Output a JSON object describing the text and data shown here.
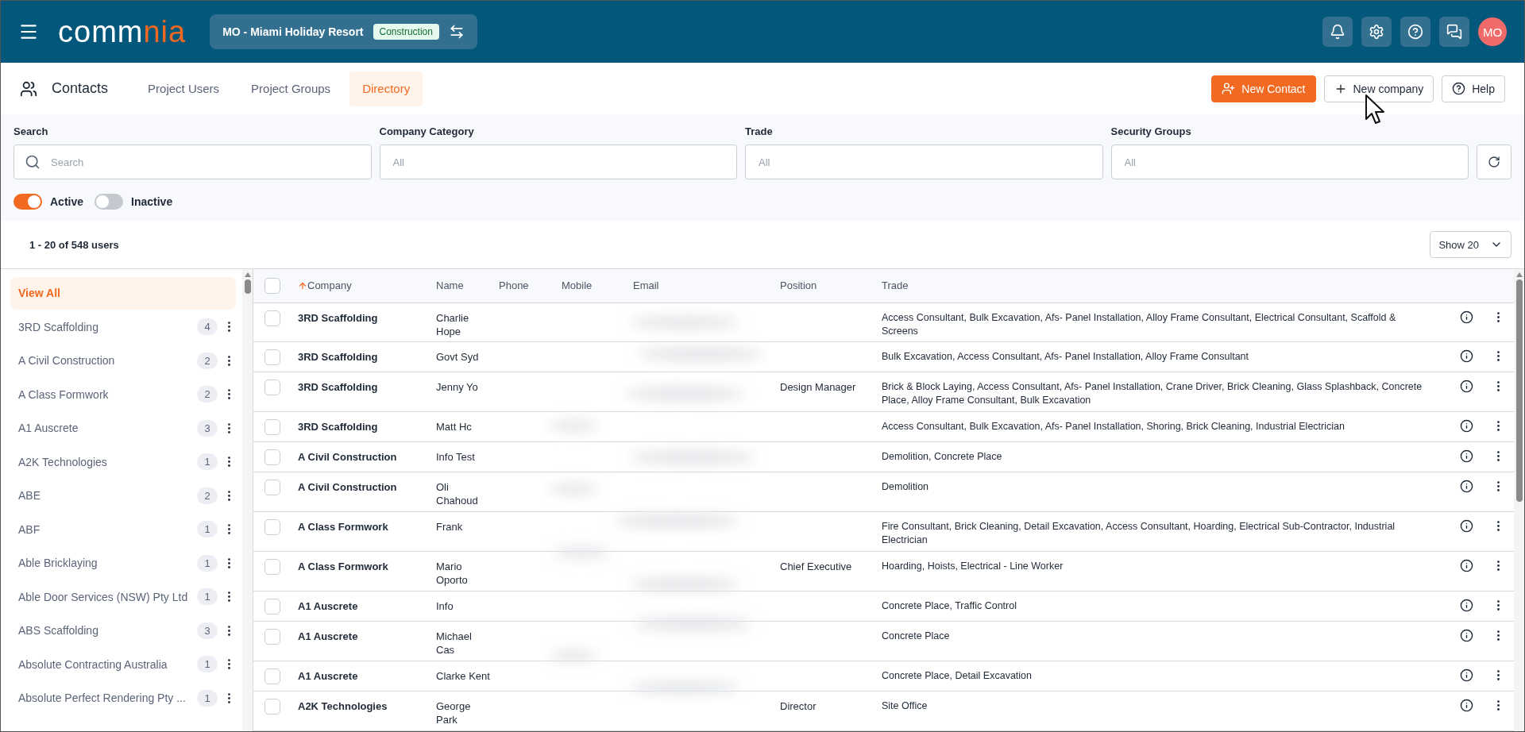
{
  "header": {
    "logo": {
      "primary": "comm",
      "accent": "nia"
    },
    "project": "MO - Miami Holiday Resort",
    "project_badge": "Construction",
    "avatar": "MO"
  },
  "page": {
    "title": "Contacts",
    "tabs": [
      {
        "label": "Project Users",
        "selected": false
      },
      {
        "label": "Project Groups",
        "selected": false
      },
      {
        "label": "Directory",
        "selected": true
      }
    ],
    "actions": [
      {
        "kind": "primary",
        "label": "New Contact"
      },
      {
        "kind": "add",
        "label": "New company"
      },
      {
        "kind": "help",
        "label": "Help"
      }
    ]
  },
  "filters": [
    {
      "kind": "search",
      "label": "Search",
      "placeholder": "Search"
    },
    {
      "kind": "select",
      "label": "Company Category",
      "placeholder": "All"
    },
    {
      "kind": "select",
      "label": "Trade",
      "placeholder": "All"
    },
    {
      "kind": "select",
      "label": "Security Groups",
      "placeholder": "All"
    }
  ],
  "toggles": [
    {
      "label": "Active",
      "on": true
    },
    {
      "label": "Inactive",
      "on": false
    }
  ],
  "count": "1 - 20 of 548 users",
  "page_size": "Show 20",
  "sidebar": {
    "items": [
      {
        "label": "View All",
        "selected": true
      },
      {
        "label": "3RD Scaffolding",
        "count": "4",
        "selected": false
      },
      {
        "label": "A Civil Construction",
        "count": "2",
        "selected": false
      },
      {
        "label": "A Class Formwork",
        "count": "2",
        "selected": false
      },
      {
        "label": "A1 Auscrete",
        "count": "3",
        "selected": false
      },
      {
        "label": "A2K Technologies",
        "count": "1",
        "selected": false
      },
      {
        "label": "ABE",
        "count": "2",
        "selected": false
      },
      {
        "label": "ABF",
        "count": "1",
        "selected": false
      },
      {
        "label": "Able Bricklaying",
        "count": "1",
        "selected": false
      },
      {
        "label": "Able Door Services (NSW) Pty Ltd",
        "count": "1",
        "selected": false
      },
      {
        "label": "ABS Scaffolding",
        "count": "3",
        "selected": false
      },
      {
        "label": "Absolute Contracting Australia",
        "count": "1",
        "selected": false
      },
      {
        "label": "Absolute Perfect Rendering Pty ...",
        "count": "1",
        "selected": false
      }
    ]
  },
  "table": {
    "select_all": {
      "checked": false
    },
    "columns": [
      {
        "label": "Company",
        "sorted": true
      },
      {
        "label": "Name",
        "sorted": false
      },
      {
        "label": "Phone",
        "sorted": false
      },
      {
        "label": "Mobile",
        "sorted": false
      },
      {
        "label": "Email",
        "sorted": false
      },
      {
        "label": "Position",
        "sorted": false
      },
      {
        "label": "Trade",
        "sorted": false
      }
    ],
    "rows": [
      {
        "checked": false,
        "company": "3RD Scaffolding",
        "name": "Charlie Hope",
        "trade": "Access Consultant, Bulk Excavation, Afs- Panel Installation, Alloy Frame Consultant, Electrical Consultant, Scaffold & Screens"
      },
      {
        "checked": false,
        "company": "3RD Scaffolding",
        "name": "Govt Syd",
        "trade": "Bulk Excavation, Access Consultant, Afs- Panel Installation, Alloy Frame Consultant"
      },
      {
        "checked": false,
        "company": "3RD Scaffolding",
        "name": "Jenny Yo",
        "position": "Design Manager",
        "trade": "Brick & Block Laying, Access Consultant, Afs- Panel Installation, Crane Driver, Brick Cleaning, Glass Splashback, Concrete Place, Alloy Frame Consultant, Bulk Excavation"
      },
      {
        "checked": false,
        "company": "3RD Scaffolding",
        "name": "Matt Hc",
        "trade": "Access Consultant, Bulk Excavation, Afs- Panel Installation, Shoring, Brick Cleaning, Industrial Electrician"
      },
      {
        "checked": false,
        "company": "A Civil Construction",
        "name": "Info Test",
        "trade": "Demolition, Concrete Place"
      },
      {
        "checked": false,
        "company": "A Civil Construction",
        "name": "Oli Chahoud",
        "trade": "Demolition"
      },
      {
        "checked": false,
        "company": "A Class Formwork",
        "name": "Frank",
        "trade": "Fire Consultant, Brick Cleaning, Detail Excavation, Access Consultant, Hoarding, Electrical Sub-Contractor, Industrial Electrician"
      },
      {
        "checked": false,
        "company": "A Class Formwork",
        "name": "Mario Oporto",
        "position": "Chief Executive",
        "trade": "Hoarding, Hoists, Electrical - Line Worker"
      },
      {
        "checked": false,
        "company": "A1 Auscrete",
        "name": "Info",
        "trade": "Concrete Place, Traffic Control"
      },
      {
        "checked": false,
        "company": "A1 Auscrete",
        "name": "Michael Cas",
        "trade": "Concrete Place"
      },
      {
        "checked": false,
        "company": "A1 Auscrete",
        "name": "Clarke Kent",
        "trade": "Concrete Place, Detail Excavation"
      },
      {
        "checked": false,
        "company": "A2K Technologies",
        "name": "George Park",
        "position": "Director",
        "trade": "Site Office"
      }
    ]
  }
}
